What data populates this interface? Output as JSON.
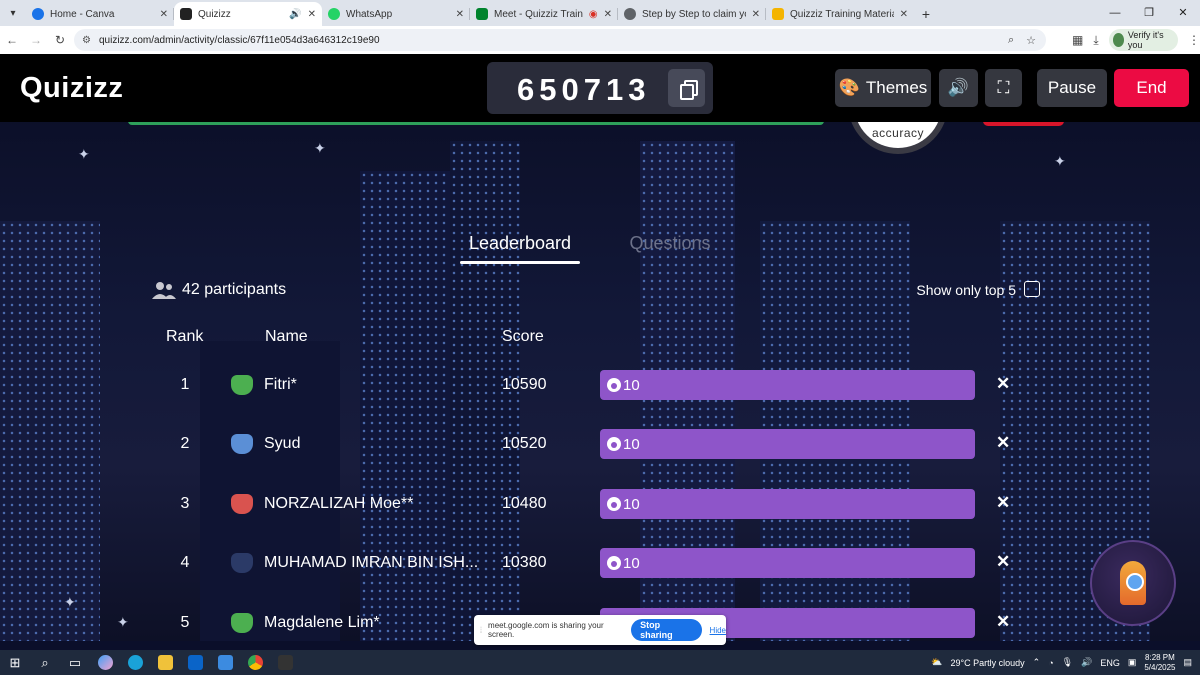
{
  "browser": {
    "tabs": [
      {
        "title": "Home - Canva",
        "color": "#1a73e8",
        "active": false
      },
      {
        "title": "Quizizz",
        "color": "#222222",
        "active": true
      },
      {
        "title": "WhatsApp",
        "color": "#25d366",
        "active": false
      },
      {
        "title": "Meet - Quizziz Training Ses",
        "color": "#00832d",
        "active": false
      },
      {
        "title": "Step by Step to claim your certi",
        "color": "#5f6368",
        "active": false
      },
      {
        "title": "Quizziz Training Material - Goo",
        "color": "#f4b400",
        "active": false
      }
    ],
    "url": "quizizz.com/admin/activity/classic/67f11e054d3a646312c19e90",
    "verify_label": "Verify it's you"
  },
  "header": {
    "logo": "Quizizz",
    "game_code": "650713",
    "themes_label": "Themes",
    "pause_label": "Pause",
    "end_label": "End",
    "accuracy_label": "accuracy"
  },
  "tabs": {
    "leaderboard": "Leaderboard",
    "questions": "Questions"
  },
  "panel": {
    "participants": "42 participants",
    "top5_label": "Show only top 5"
  },
  "columns": {
    "rank": "Rank",
    "name": "Name",
    "score": "Score"
  },
  "rows": [
    {
      "rank": "1",
      "name": "Fitri*",
      "score": "10590",
      "streak": "10",
      "avatar_color": "#4caf50"
    },
    {
      "rank": "2",
      "name": "Syud",
      "score": "10520",
      "streak": "10",
      "avatar_color": "#5b8fd6"
    },
    {
      "rank": "3",
      "name": "NORZALIZAH Moe**",
      "score": "10480",
      "streak": "10",
      "avatar_color": "#d9534f"
    },
    {
      "rank": "4",
      "name": "MUHAMAD IMRAN BIN ISH...",
      "score": "10380",
      "streak": "10",
      "avatar_color": "#2b3a67"
    },
    {
      "rank": "5",
      "name": "Magdalene Lim*",
      "score": "",
      "streak": "",
      "avatar_color": "#4caf50"
    }
  ],
  "share_bar": {
    "text": "meet.google.com is sharing your screen.",
    "stop_label": "Stop sharing",
    "hide_label": "Hide"
  },
  "taskbar": {
    "weather": "29°C  Partly cloudy",
    "lang": "ENG",
    "time": "8:28 PM",
    "date": "5/4/2025"
  }
}
